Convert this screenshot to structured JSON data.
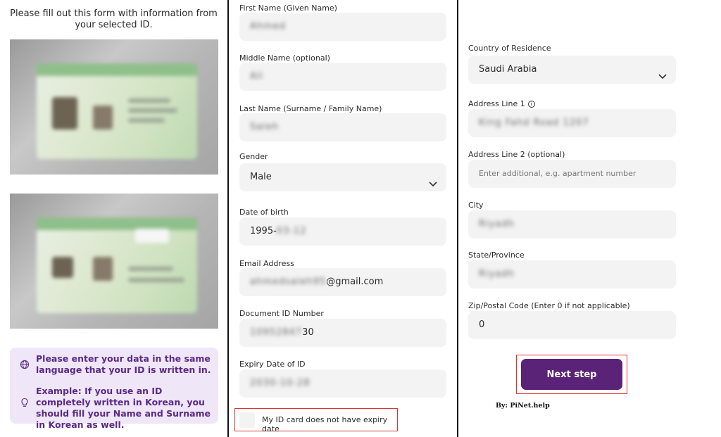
{
  "left": {
    "intro": "Please fill out this form with information from your selected ID.",
    "notice": {
      "line1": "Please enter your data in the same language that your ID is written in.",
      "line2": "Example: If you use an ID completely written in Korean, you should fill your Name and Surname in Korean as well.",
      "icon1": "globe-icon",
      "icon2": "lightbulb-icon",
      "color": "#5a2a86",
      "background": "#efe6f8"
    }
  },
  "middle": {
    "first_name": {
      "label": "First Name (Given Name)",
      "value": "Ahmed"
    },
    "middle_name": {
      "label": "Middle Name (optional)",
      "value": "Ali"
    },
    "last_name": {
      "label": "Last Name (Surname / Family Name)",
      "value": "Saleh"
    },
    "gender": {
      "label": "Gender",
      "value": "Male"
    },
    "dob": {
      "label": "Date of birth",
      "value_visible": "1995-",
      "value_hidden": "03-12"
    },
    "email": {
      "label": "Email Address",
      "value_hidden": "ahmedsaleh95",
      "value_visible": "@gmail.com"
    },
    "doc_id": {
      "label": "Document ID Number",
      "value_hidden": "10952847",
      "value_visible": "30"
    },
    "expiry": {
      "label": "Expiry Date of ID",
      "value": "2030-10-28"
    },
    "no_expiry_label": "My ID card does not have expiry date"
  },
  "right": {
    "country": {
      "label": "Country of Residence",
      "value": "Saudi Arabia"
    },
    "address1": {
      "label": "Address Line 1",
      "value": "King Fahd Road 1207"
    },
    "address2": {
      "label": "Address Line 2 (optional)",
      "placeholder": "Enter additional, e.g. apartment number"
    },
    "city": {
      "label": "City",
      "value": "Riyadh"
    },
    "state": {
      "label": "State/Province",
      "value": "Riyadh"
    },
    "zip": {
      "label": "Zip/Postal Code (Enter 0 if not applicable)",
      "value": "0"
    },
    "next_label": "Next step",
    "credit": "By: PiNet.help",
    "accent": "#5a2378",
    "highlight": "#dd3333"
  }
}
